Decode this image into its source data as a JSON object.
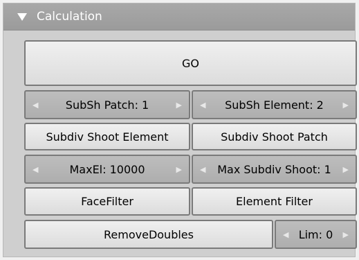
{
  "panel": {
    "title": "Calculation"
  },
  "buttons": {
    "go": "GO",
    "subsh_patch": "SubSh Patch: 1",
    "subsh_element": "SubSh Element: 2",
    "subdiv_shoot_element": "Subdiv Shoot Element",
    "subdiv_shoot_patch": "Subdiv Shoot Patch",
    "maxel": "MaxEl: 10000",
    "max_subdiv_shoot": "Max Subdiv Shoot: 1",
    "face_filter": "FaceFilter",
    "element_filter": "Element Filter",
    "remove_doubles": "RemoveDoubles",
    "lim": "Lim: 0"
  },
  "icons": {
    "collapse": "triangle-down-icon",
    "decrement": "arrow-left-icon",
    "increment": "arrow-right-icon"
  }
}
